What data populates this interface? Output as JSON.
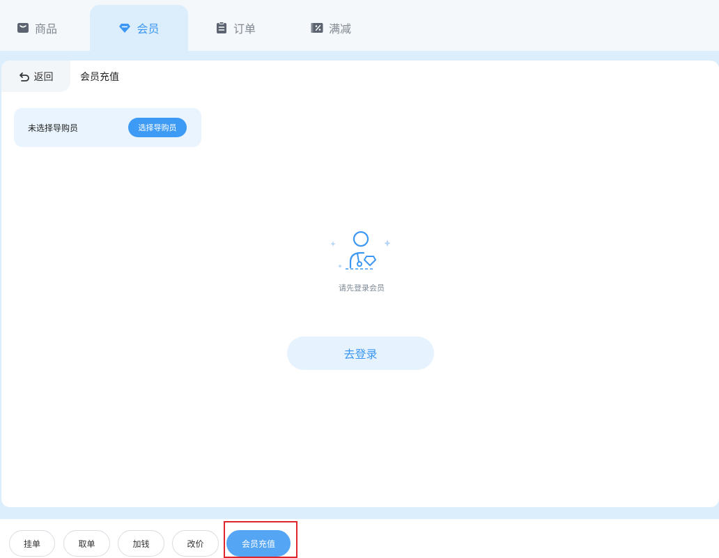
{
  "tabs": [
    {
      "label": "商品",
      "icon": "bag-icon"
    },
    {
      "label": "会员",
      "icon": "diamond-icon",
      "active": true
    },
    {
      "label": "订单",
      "icon": "clipboard-icon"
    },
    {
      "label": "满减",
      "icon": "discount-icon"
    }
  ],
  "header": {
    "back_label": "返回",
    "title": "会员充值"
  },
  "guide": {
    "status_text": "未选择导购员",
    "select_button": "选择导购员"
  },
  "empty_state": {
    "message": "请先登录会员",
    "login_button": "去登录"
  },
  "bottom_actions": [
    {
      "label": "挂单"
    },
    {
      "label": "取单"
    },
    {
      "label": "加钱"
    },
    {
      "label": "改价"
    },
    {
      "label": "会员充值",
      "primary": true
    }
  ],
  "colors": {
    "accent": "#3b97f3",
    "tab_active_bg": "#dcedfb",
    "primary_button": "#54a6f5",
    "highlight": "#e0242b"
  }
}
